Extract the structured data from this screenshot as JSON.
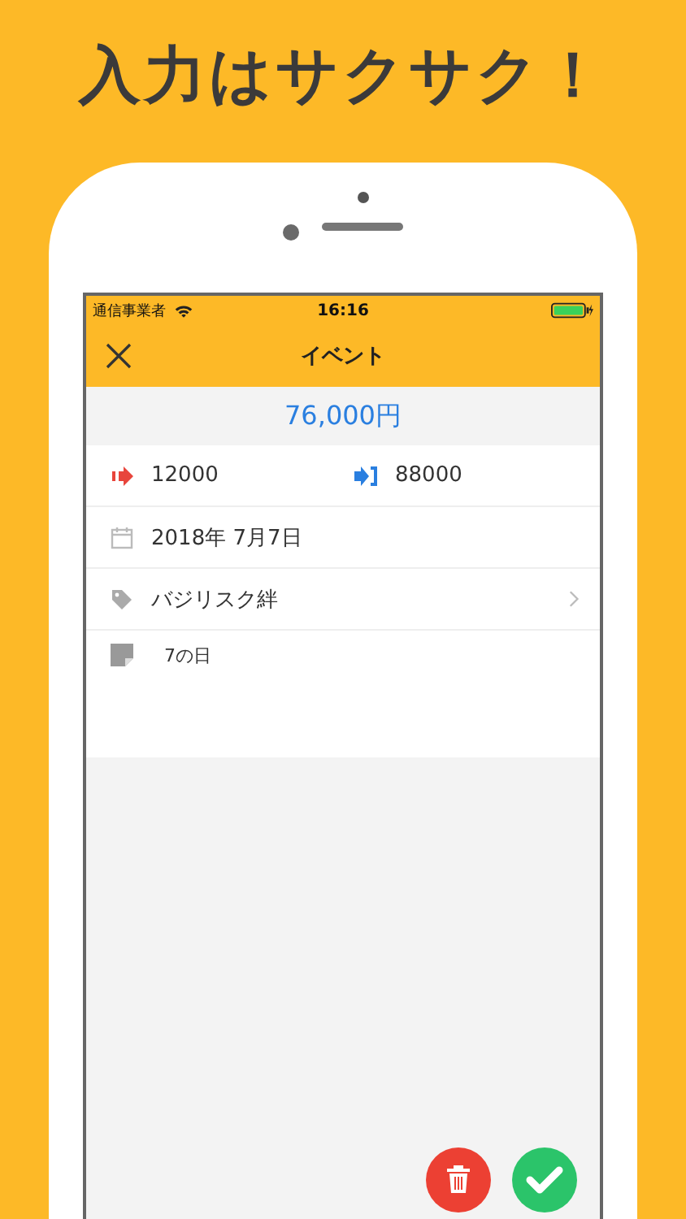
{
  "headline": "入力はサクサク！",
  "status_bar": {
    "carrier": "通信事業者",
    "time": "16:16"
  },
  "nav_bar": {
    "title": "イベント"
  },
  "total": "76,000円",
  "fields": [
    {
      "kind": "amounts",
      "out": "12000",
      "in": "88000"
    },
    {
      "kind": "date",
      "value": "2018年 7月7日"
    },
    {
      "kind": "tag",
      "value": "バジリスク絆"
    },
    {
      "kind": "memo",
      "value": "7の日"
    }
  ]
}
